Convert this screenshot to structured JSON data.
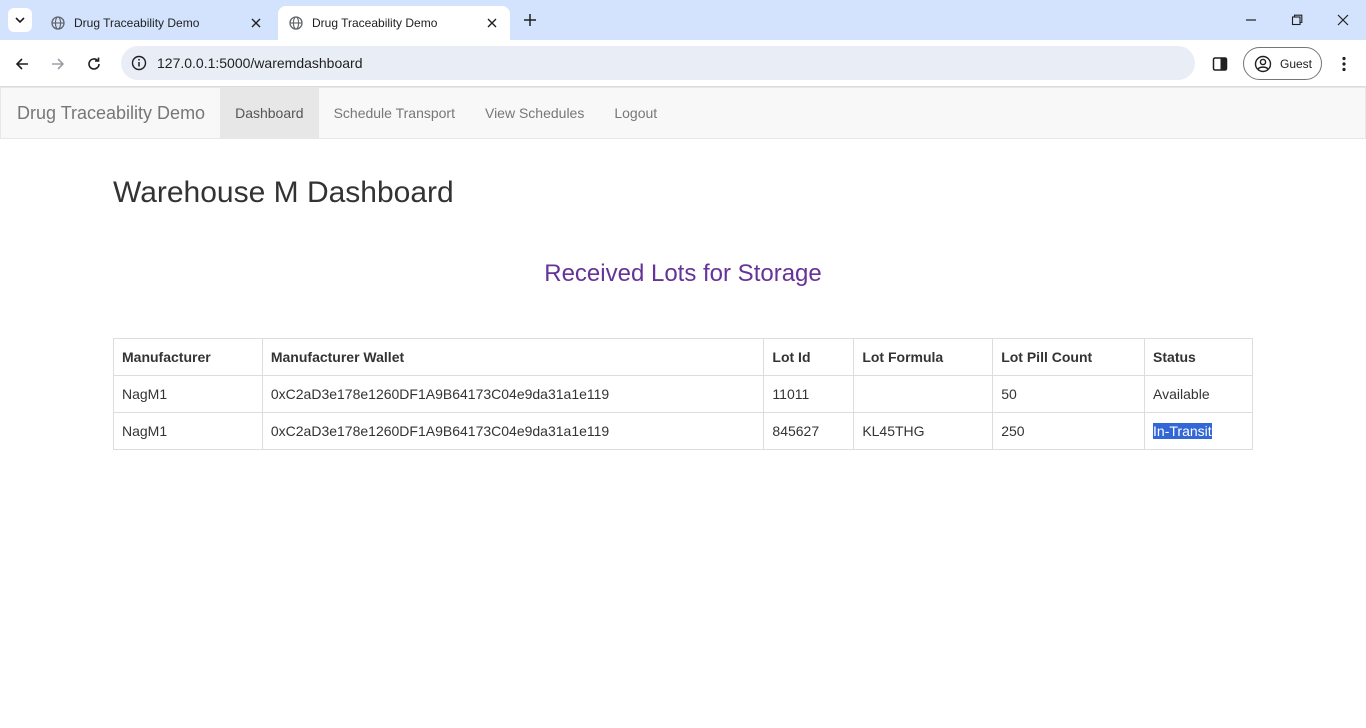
{
  "browser": {
    "tabs": [
      {
        "title": "Drug Traceability Demo",
        "active": false
      },
      {
        "title": "Drug Traceability Demo",
        "active": true
      }
    ],
    "url": "127.0.0.1:5000/waremdashboard",
    "profile_label": "Guest"
  },
  "navbar": {
    "brand": "Drug Traceability Demo",
    "links": [
      "Dashboard",
      "Schedule Transport",
      "View Schedules",
      "Logout"
    ],
    "active_link": "Dashboard"
  },
  "page": {
    "title": "Warehouse M Dashboard",
    "section_title": "Received Lots for Storage"
  },
  "table": {
    "headers": [
      "Manufacturer",
      "Manufacturer Wallet",
      "Lot Id",
      "Lot Formula",
      "Lot Pill Count",
      "Status"
    ],
    "rows": [
      [
        "NagM1",
        "0xC2aD3e178e1260DF1A9B64173C04e9da31a1e119",
        "11011",
        "",
        "50",
        "Available"
      ],
      [
        "NagM1",
        "0xC2aD3e178e1260DF1A9B64173C04e9da31a1e119",
        "845627",
        "KL45THG",
        "250",
        "In-Transit"
      ]
    ]
  },
  "colors": {
    "tabstrip": "#d3e3fd",
    "section_title": "#663399",
    "selection": "#3367d6"
  }
}
